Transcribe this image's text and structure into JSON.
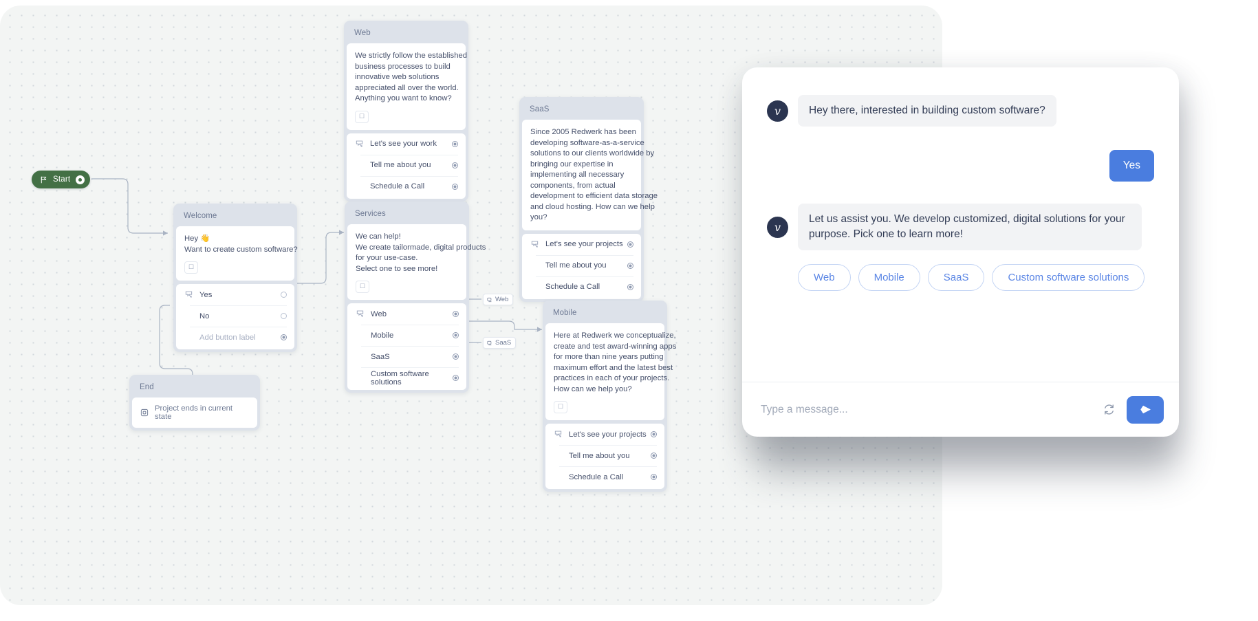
{
  "start_node": {
    "label": "Start",
    "icon": "flag-icon"
  },
  "nodes": [
    {
      "id": "welcome",
      "title": "Welcome",
      "message_lines": [
        "Hey 👋",
        "Want to create custom software?"
      ],
      "emoji_button": "emoji-picker-icon",
      "buttons": [
        {
          "label": "Yes",
          "port": "open",
          "first": true
        },
        {
          "label": "No",
          "port": "open",
          "first": false
        },
        {
          "label": "Add button label",
          "port": "filled",
          "placeholder": true,
          "first": false
        }
      ]
    },
    {
      "id": "web",
      "title": "Web",
      "message_lines": [
        "We strictly follow the established",
        "business processes to build",
        "innovative web solutions",
        "appreciated all over the world.",
        "Anything you want to know?"
      ],
      "emoji_button": "emoji-picker-icon",
      "buttons": [
        {
          "label": "Let's see your work",
          "port": "filled",
          "first": true
        },
        {
          "label": "Tell me about you",
          "port": "filled",
          "first": false
        },
        {
          "label": "Schedule a Call",
          "port": "filled",
          "first": false
        }
      ]
    },
    {
      "id": "services",
      "title": "Services",
      "message_lines": [
        "We can help!",
        "We create tailormade, digital products",
        "for your use-case.",
        "Select one to see more!"
      ],
      "emoji_button": "emoji-picker-icon",
      "buttons": [
        {
          "label": "Web",
          "port": "filled",
          "first": true
        },
        {
          "label": "Mobile",
          "port": "filled",
          "first": false
        },
        {
          "label": "SaaS",
          "port": "filled",
          "first": false
        },
        {
          "label": "Custom software solutions",
          "port": "filled",
          "first": false
        }
      ]
    },
    {
      "id": "saas",
      "title": "SaaS",
      "message_lines": [
        "Since 2005 Redwerk has been",
        "developing software-as-a-service",
        "solutions to our clients worldwide by",
        "bringing our expertise in",
        "implementing all necessary",
        "components, from actual",
        "development to efficient data storage",
        "and cloud hosting. How can we help",
        "you?"
      ],
      "buttons": [
        {
          "label": "Let's see your projects",
          "port": "filled",
          "first": true
        },
        {
          "label": "Tell me about you",
          "port": "filled",
          "first": false
        },
        {
          "label": "Schedule a Call",
          "port": "filled",
          "first": false
        }
      ]
    },
    {
      "id": "mobile",
      "title": "Mobile",
      "message_lines": [
        "Here at Redwerk we conceptualize,",
        "create and test award-winning apps",
        "for more than nine years putting",
        "maximum effort and the latest best",
        "practices in each of your projects.",
        "How can we help you?"
      ],
      "emoji_button": "emoji-picker-icon",
      "buttons": [
        {
          "label": "Let's see your projects",
          "port": "filled",
          "first": true
        },
        {
          "label": "Tell me about you",
          "port": "filled",
          "first": false
        },
        {
          "label": "Schedule a Call",
          "port": "filled",
          "first": false
        }
      ]
    },
    {
      "id": "end",
      "title": "End",
      "status_text": "Project ends in current state",
      "status_icon": "stop-square-icon"
    }
  ],
  "edge_chips": [
    {
      "label": "Web",
      "icon": "node-link-icon"
    },
    {
      "label": "SaaS",
      "icon": "node-link-icon"
    }
  ],
  "chat": {
    "avatar_glyph": "v",
    "messages": [
      {
        "from": "bot",
        "text": "Hey there, interested in building custom software?"
      },
      {
        "from": "user",
        "text": "Yes"
      },
      {
        "from": "bot",
        "text": "Let us assist you. We develop customized, digital solutions for your purpose. Pick one to learn more!"
      }
    ],
    "quick_replies": [
      "Web",
      "Mobile",
      "SaaS",
      "Custom software solutions"
    ],
    "input_placeholder": "Type a message...",
    "refresh_icon": "restart-icon",
    "send_icon": "send-icon"
  },
  "colors": {
    "start_green": "#437045",
    "node_header": "#dde2ea",
    "canvas": "#f3f5f4",
    "accent_blue": "#4a7ddf",
    "pill_border": "#c3d4f4",
    "bot_bubble": "#f2f3f5",
    "avatar_navy": "#2b3550",
    "text_dark": "#46506b"
  }
}
